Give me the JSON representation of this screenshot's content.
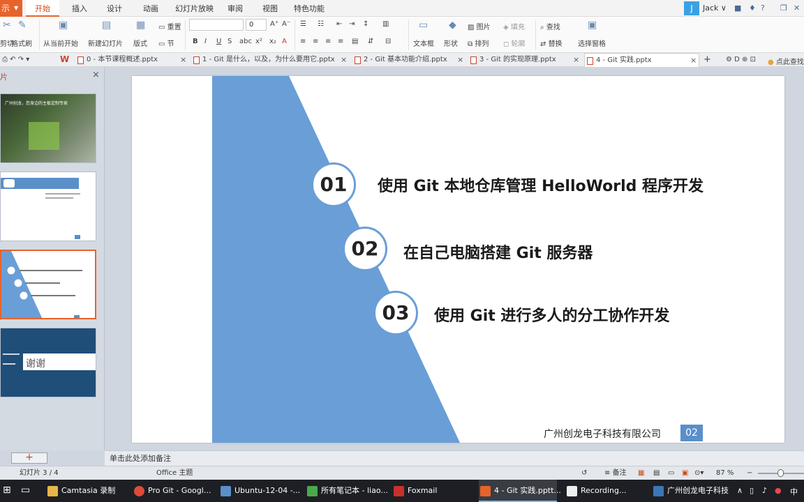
{
  "app": {
    "app_button": "示",
    "menu_tabs": [
      "开始",
      "插入",
      "设计",
      "动画",
      "幻灯片放映",
      "审阅",
      "视图",
      "特色功能"
    ],
    "active_tab": "开始",
    "user_initial": "J",
    "user_name": "Jack ∨"
  },
  "ribbon": {
    "cut": "剪切",
    "format_painter": "格式刷",
    "from_current": "从当前开始",
    "new_slide": "新建幻灯片",
    "layout": "版式",
    "reset": "重置",
    "section": "节",
    "font_size": "0",
    "textbox": "文本框",
    "shapes": "形状",
    "picture": "图片",
    "arrange": "排列",
    "fill": "填充",
    "outline": "轮廓",
    "find": "查找",
    "replace": "替换",
    "selection_pane": "选择窗格"
  },
  "doc_tabs": [
    {
      "label": "0 - 本节课程概述.pptx"
    },
    {
      "label": "1 - Git 是什么，以及，为什么要用它.pptx"
    },
    {
      "label": "2 - Git 基本功能介绍.pptx"
    },
    {
      "label": "3 - Git 的实现原理.pptx"
    },
    {
      "label": "4 - Git 实践.pptx"
    }
  ],
  "click_find": "点此查找",
  "thumb_pane": {
    "header": "片",
    "thumb1_text": "广州创龙，您身边的主板定制专家",
    "thumb4_text": "谢谢"
  },
  "slide": {
    "items": [
      {
        "num": "01",
        "text": "使用 Git 本地仓库管理 HelloWorld 程序开发"
      },
      {
        "num": "02",
        "text": "在自己电脑搭建 Git 服务器"
      },
      {
        "num": "03",
        "text": "使用 Git 进行多人的分工协作开发"
      }
    ],
    "company": "广州创龙电子科技有限公司",
    "page_badge": "02",
    "colors": {
      "accent_blue": "#6a9ed6",
      "triangle_blue": "#6a9ed6"
    }
  },
  "notes_placeholder": "单击此处添加备注",
  "status": {
    "slide_counter": "幻灯片 3 / 4",
    "theme": "Office 主题",
    "notes_btn": "备注",
    "zoom": "87 %"
  },
  "taskbar": {
    "items": [
      {
        "label": "Camtasia 录制"
      },
      {
        "label": "Pro Git - Googl..."
      },
      {
        "label": "Ubuntu-12-04 -..."
      },
      {
        "label": "所有笔记本 - liao..."
      },
      {
        "label": "Foxmail"
      },
      {
        "label": "4 - Git 实践.pptt..."
      },
      {
        "label": "Recording..."
      },
      {
        "label": "广州创龙电子科技"
      }
    ],
    "ime": "中"
  }
}
